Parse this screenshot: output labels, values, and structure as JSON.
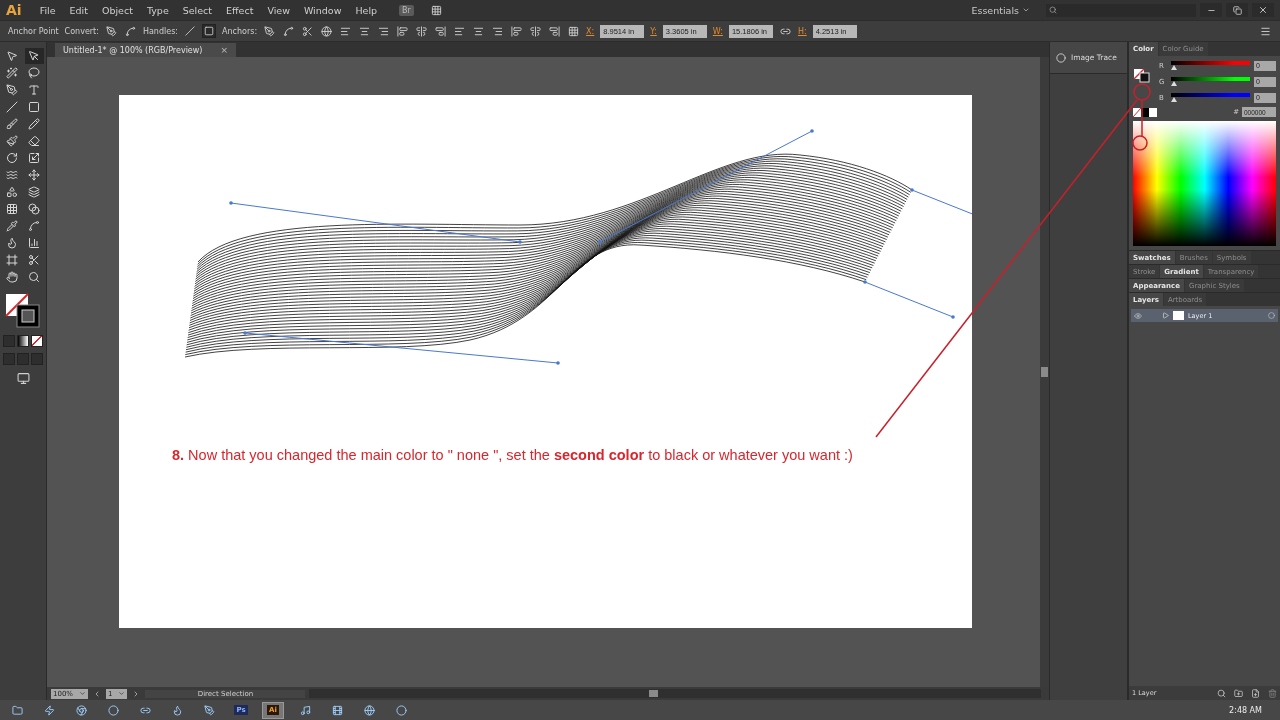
{
  "app": {
    "logo": "Ai",
    "menu": [
      "File",
      "Edit",
      "Object",
      "Type",
      "Select",
      "Effect",
      "View",
      "Window",
      "Help"
    ],
    "bridge": "Br",
    "workspace": "Essentials"
  },
  "control_bar": {
    "mode": "Anchor Point",
    "convert": "Convert:",
    "handles": "Handles:",
    "handle_buttons": [
      {
        "selected": false
      },
      {
        "selected": true
      }
    ],
    "anchors": "Anchors:",
    "fields": [
      {
        "label": "X:",
        "value": "8.9514 in"
      },
      {
        "label": "Y:",
        "value": "3.3605 in"
      },
      {
        "label": "W:",
        "value": "15.1806 in"
      },
      {
        "label": "H:",
        "value": "4.2513 in"
      }
    ]
  },
  "document_tab": {
    "title": "Untitled-1* @ 100% (RGB/Preview)",
    "close": "×"
  },
  "toolbox": {
    "tools": [
      {
        "selected": false
      },
      {
        "selected": true
      },
      {
        "selected": false
      },
      {
        "selected": false
      },
      {
        "selected": false
      },
      {
        "selected": false
      },
      {
        "selected": false
      },
      {
        "selected": false
      },
      {
        "selected": false
      },
      {
        "selected": false
      },
      {
        "selected": false
      },
      {
        "selected": false
      },
      {
        "selected": false
      },
      {
        "selected": false
      },
      {
        "selected": false
      },
      {
        "selected": false
      },
      {
        "selected": false
      },
      {
        "selected": false
      },
      {
        "selected": false
      },
      {
        "selected": false
      },
      {
        "selected": false
      },
      {
        "selected": false
      },
      {
        "selected": false
      },
      {
        "selected": false
      },
      {
        "selected": false
      },
      {
        "selected": false
      },
      {
        "selected": false
      },
      {
        "selected": false
      }
    ]
  },
  "annotation": "**8.** Now that you changed the main color to \" none \", set the **second color** to black or whatever you want :)",
  "image_trace": "Image Trace",
  "color_panel": {
    "tabs": [
      {
        "label": "Color",
        "selected": true
      },
      {
        "label": "Color Guide",
        "selected": false
      }
    ],
    "channels": [
      {
        "name": "R",
        "level": 0,
        "value": "0",
        "color": "#ff0000"
      },
      {
        "name": "G",
        "level": 0,
        "value": "0",
        "color": "#00ff00"
      },
      {
        "name": "B",
        "level": 0,
        "value": "0",
        "color": "#0000ff"
      }
    ],
    "hex_label": "#",
    "hex": "000000"
  },
  "panel_groups": [
    {
      "tabs": [
        {
          "label": "Swatches",
          "selected": true
        },
        {
          "label": "Brushes",
          "selected": false
        },
        {
          "label": "Symbols",
          "selected": false
        }
      ]
    },
    {
      "tabs": [
        {
          "label": "Stroke",
          "selected": false
        },
        {
          "label": "Gradient",
          "selected": true
        },
        {
          "label": "Transparency",
          "selected": false
        }
      ]
    },
    {
      "tabs": [
        {
          "label": "Appearance",
          "selected": true
        },
        {
          "label": "Graphic Styles",
          "selected": false
        }
      ]
    },
    {
      "tabs": [
        {
          "label": "Layers",
          "selected": true
        },
        {
          "label": "Artboards",
          "selected": false
        }
      ]
    }
  ],
  "layers": {
    "rows": [
      {
        "name": "Layer 1",
        "selected": true
      }
    ],
    "footer": "1 Layer"
  },
  "status_bar": {
    "zoom": "100%",
    "artboard": "1",
    "tool": "Direct Selection"
  },
  "taskbar": {
    "apps": [
      {
        "selected": false
      },
      {
        "selected": false
      },
      {
        "selected": false
      },
      {
        "selected": false
      },
      {
        "selected": false
      },
      {
        "selected": false
      },
      {
        "selected": false
      },
      {
        "label": "Ps",
        "selected": false
      },
      {
        "label": "Ai",
        "selected": true
      },
      {
        "selected": false
      },
      {
        "selected": false
      },
      {
        "selected": false
      },
      {
        "selected": false
      }
    ],
    "time": "2:48 AM"
  }
}
